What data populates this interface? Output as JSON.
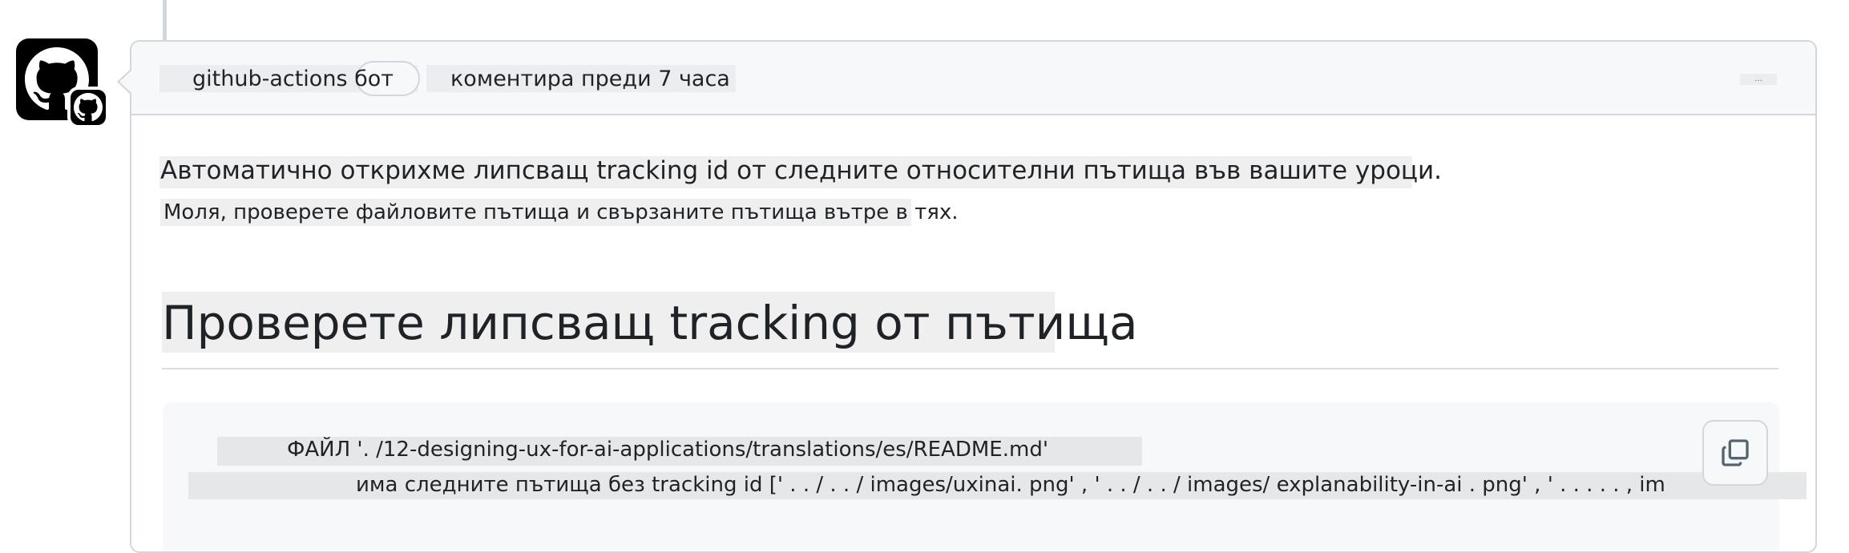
{
  "comment": {
    "author": "github-actions бот",
    "timestamp": "коментира преди 7 часа",
    "menu_label": "...",
    "avatar_icon": "github-icon"
  },
  "body": {
    "paragraph1": "Автоматично открихме липсващ tracking id от следните относителни пътища във вашите уроци.",
    "paragraph2": "Моля, проверете файловите пътища и свързаните пътища вътре в тях.",
    "heading": "Проверете липсващ tracking от пътища",
    "code_line1": "ФАЙЛ '. /12-designing-ux-for-ai-applications/translations/es/README.md'",
    "code_line2": "има следните пътища без tracking id [' . . / . . / images/uxinai. png' , ' . . / . . / images/ explanability-in-ai . png' , ' . . . . . , im",
    "copy_icon": "copy-icon"
  },
  "colors": {
    "border": "#d0d7de",
    "header_bg": "#f6f8fa",
    "text": "#1f2328"
  }
}
